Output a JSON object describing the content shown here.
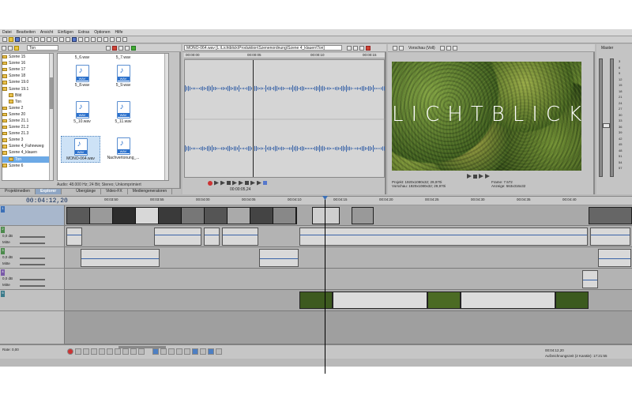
{
  "menu": [
    "Datei",
    "Bearbeiten",
    "Ansicht",
    "Einfügen",
    "Extras",
    "Optionen",
    "Hilfe"
  ],
  "explorer": {
    "path": "Ton",
    "tree": [
      "Szene 15",
      "Szene 16",
      "Szene 17",
      "Szene 18",
      "Szene 19.0",
      "Szene 19.1",
      "Bild",
      "Ton",
      "Szene 2",
      "Szene 20",
      "Szene 21.1",
      "Szene 21.2",
      "Szene 21.3",
      "Szene 3",
      "Szene 4_Fahneweg",
      "Szene 4_klauen",
      "Ton",
      "Szene 6"
    ],
    "selected_tree_item": "Ton",
    "files": [
      "5_6.wav",
      "5_7.wav",
      "5_8.wav",
      "5_9.wav",
      "5_10.wav",
      "5_11.wav",
      "MONO-064.wav",
      "Nachvertonung_..."
    ],
    "wav_label": "WAV",
    "status": "Audio: 48.000 Hz; 24 Bit; Stereo; Unkomprimiert",
    "tabs_left": [
      "Projektmedien",
      "Explorer"
    ],
    "active_tab": "Explorer",
    "tabs_right": [
      "Übergänge",
      "Video-FX",
      "Mediengeneratoren"
    ]
  },
  "trimmer": {
    "file_path": "MONO-064.wav  [L:\\Lichtblick\\Produktion\\Szenenordnung\\Szene 4_klauen\\Ton]",
    "ruler": [
      "00:00:00",
      "00:00:05",
      "00:00:10",
      "00:00:15"
    ],
    "time": "00:00:05,24"
  },
  "preview": {
    "label": "Vorschau (Voll)",
    "title": "LICHTBLICK",
    "projekt_label": "Projekt:",
    "projekt_value": "1920x1080x32; 29,970i",
    "vorschau_label": "Vorschau:",
    "vorschau_value": "1920x1080x32; 29,970i",
    "frame_label": "Frame:",
    "frame_value": "7.572",
    "anzeige_label": "Anzeige:",
    "anzeige_value": "563x316x32"
  },
  "master": {
    "label": "Master",
    "scale": [
      "3",
      "6",
      "9",
      "12",
      "15",
      "18",
      "21",
      "24",
      "27",
      "30",
      "33",
      "36",
      "39",
      "42",
      "45",
      "48",
      "51",
      "54",
      "57"
    ]
  },
  "timeline": {
    "time": "00:04:12,20",
    "ruler": [
      "00:03:50",
      "00:03:55",
      "00:04:00",
      "00:04:05",
      "00:04:10",
      "00:04:15",
      "00:04:20",
      "00:04:25",
      "00:04:30",
      "00:04:35",
      "00:04:40"
    ],
    "track_vol": "0,0 dB",
    "track_pan": "Mitte"
  },
  "bottom": {
    "rate": "Rate: 0,00",
    "time": "00:04:12,20",
    "status": "Aufzeichnungszeit (2 Kanäle): 17:21:55"
  },
  "colors": {
    "accent": "#4d7fc3",
    "waveform": "#3a64a8",
    "folder": "#e9c14c"
  }
}
